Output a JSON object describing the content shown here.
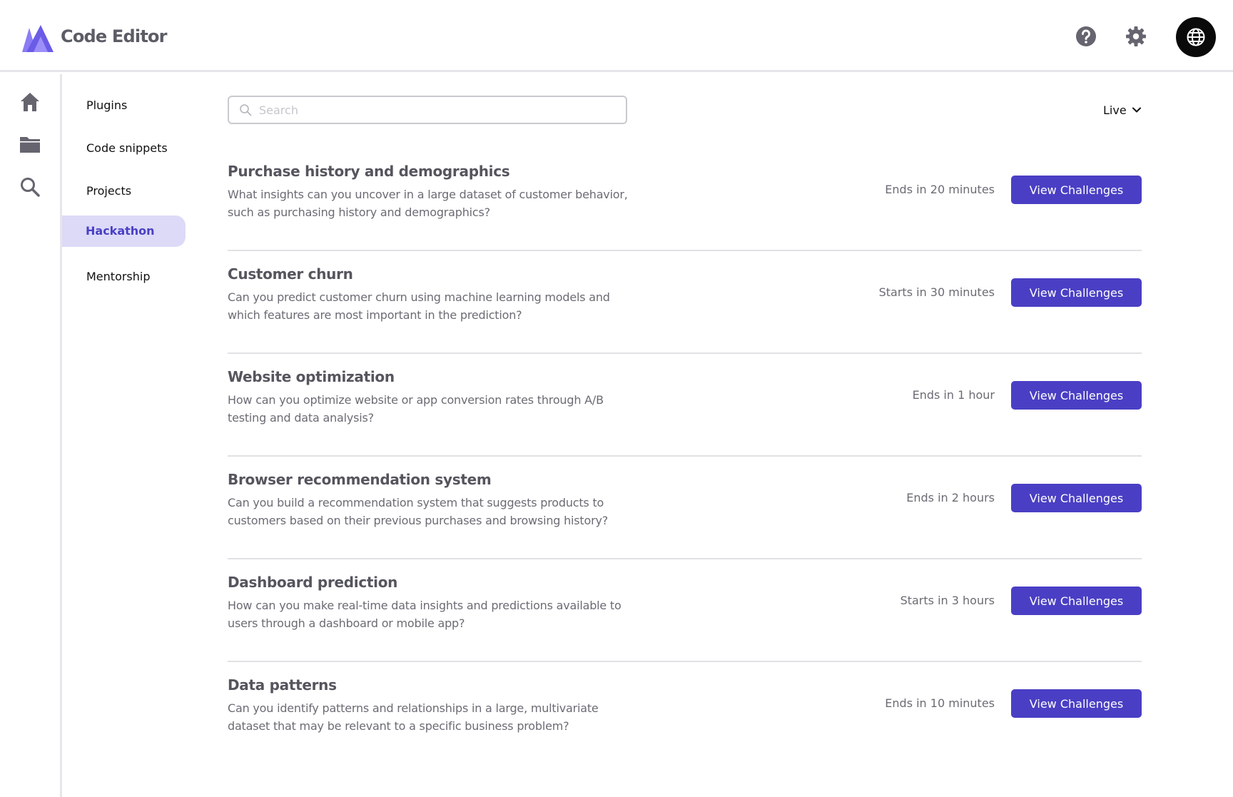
{
  "app": {
    "title": "Code Editor",
    "accent_color": "#4a3fc4",
    "logo_icon": "purple-triangle-logo"
  },
  "header": {
    "icons": [
      "help-icon",
      "gear-icon",
      "globe-icon"
    ]
  },
  "rail": {
    "icons": [
      "home-icon",
      "folder-icon",
      "search-icon"
    ]
  },
  "sidebar": {
    "items": [
      {
        "label": "Plugins",
        "active": false
      },
      {
        "label": "Code snippets",
        "active": false
      },
      {
        "label": "Projects",
        "active": false
      },
      {
        "label": "Hackathon",
        "active": true
      },
      {
        "label": "Mentorship",
        "active": false
      }
    ]
  },
  "search": {
    "placeholder": "Search",
    "value": ""
  },
  "filter": {
    "selected": "Live"
  },
  "challenges": [
    {
      "title": "Purchase history and demographics",
      "description": "What insights can you uncover in a large dataset of customer behavior, such as purchasing history and demographics?",
      "status": "Ends in 20 minutes",
      "button": "View Challenges"
    },
    {
      "title": "Customer churn",
      "description": "Can you predict customer churn using machine learning models and which features are most important in the prediction?",
      "status": "Starts in 30 minutes",
      "button": "View Challenges"
    },
    {
      "title": "Website optimization",
      "description": "How can you optimize website or app conversion rates through A/B testing and data analysis?",
      "status": "Ends in 1 hour",
      "button": "View Challenges"
    },
    {
      "title": "Browser recommendation system",
      "description": "Can you build a recommendation system that suggests products to customers based on their previous purchases and browsing history?",
      "status": "Ends in 2 hours",
      "button": "View Challenges"
    },
    {
      "title": "Dashboard prediction",
      "description": "How can you make real-time data insights and predictions available to users through a dashboard or mobile app?",
      "status": "Starts in 3 hours",
      "button": "View Challenges"
    },
    {
      "title": "Data patterns",
      "description": "Can you identify patterns and relationships in a large, multivariate dataset that may be relevant to a specific business problem?",
      "status": "Ends in 10 minutes",
      "button": "View Challenges"
    }
  ]
}
